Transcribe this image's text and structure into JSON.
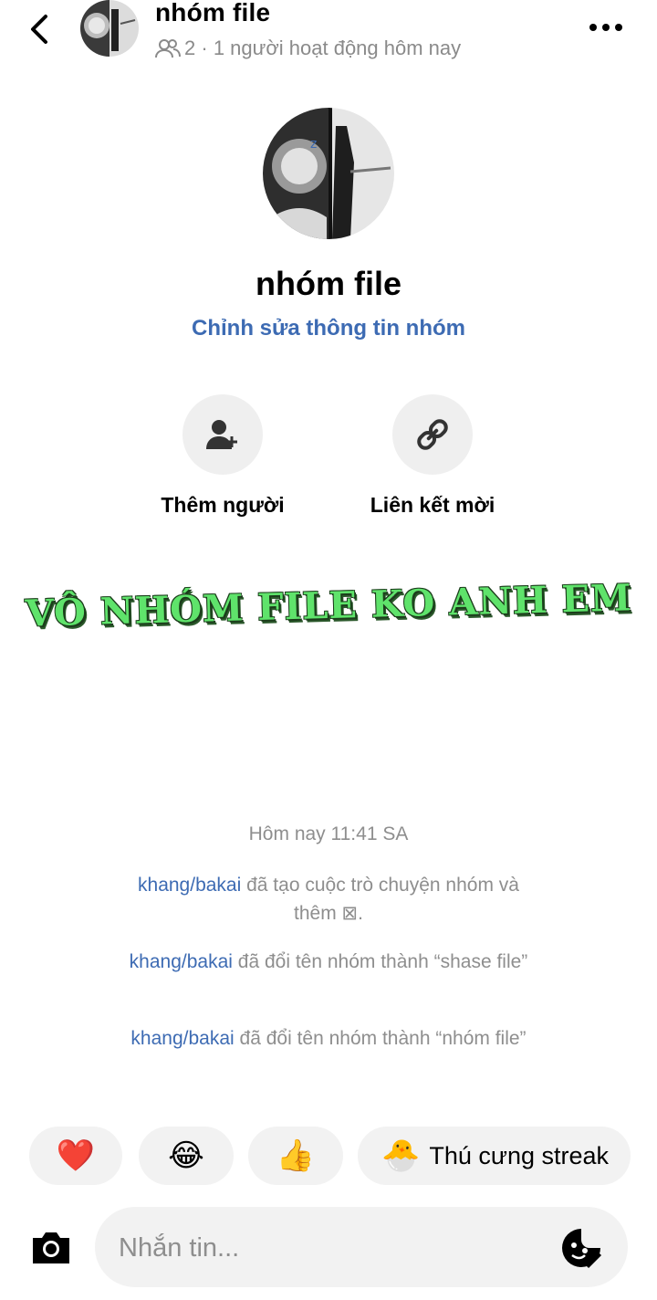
{
  "header": {
    "title": "nhóm file",
    "member_count": "2",
    "separator": " · ",
    "activity": "1 người hoạt động hôm nay"
  },
  "group": {
    "name": "nhóm file",
    "edit_link": "Chỉnh sửa thông tin nhóm"
  },
  "actions": [
    {
      "label": "Thêm người",
      "icon": "add-person-icon"
    },
    {
      "label": "Liên kết mời",
      "icon": "link-icon"
    }
  ],
  "banner_text": "VÔ NHÓM FILE KO ANH EM",
  "timeline": {
    "timestamp": "Hôm nay 11:41 SA",
    "events": [
      {
        "actor": "khang/bakai",
        "text": " đã tạo cuộc trò chuyện nhóm và thêm ⊠."
      },
      {
        "actor": "khang/bakai",
        "text": " đã đổi tên nhóm thành “shase file”"
      },
      {
        "actor": "khang/bakai",
        "text": " đã đổi tên nhóm thành “nhóm file”"
      }
    ]
  },
  "quick_replies": {
    "heart": "❤️",
    "laugh": "😂",
    "thumbs_up": "👍",
    "streak_icon": "🐣",
    "streak_label": "Thú cưng streak"
  },
  "composer": {
    "placeholder": "Nhắn tin..."
  },
  "colors": {
    "link_blue": "#3d6bb3",
    "muted_gray": "#8e8e8e",
    "chip_bg": "#f2f2f2",
    "banner_green": "#5fe36b"
  }
}
